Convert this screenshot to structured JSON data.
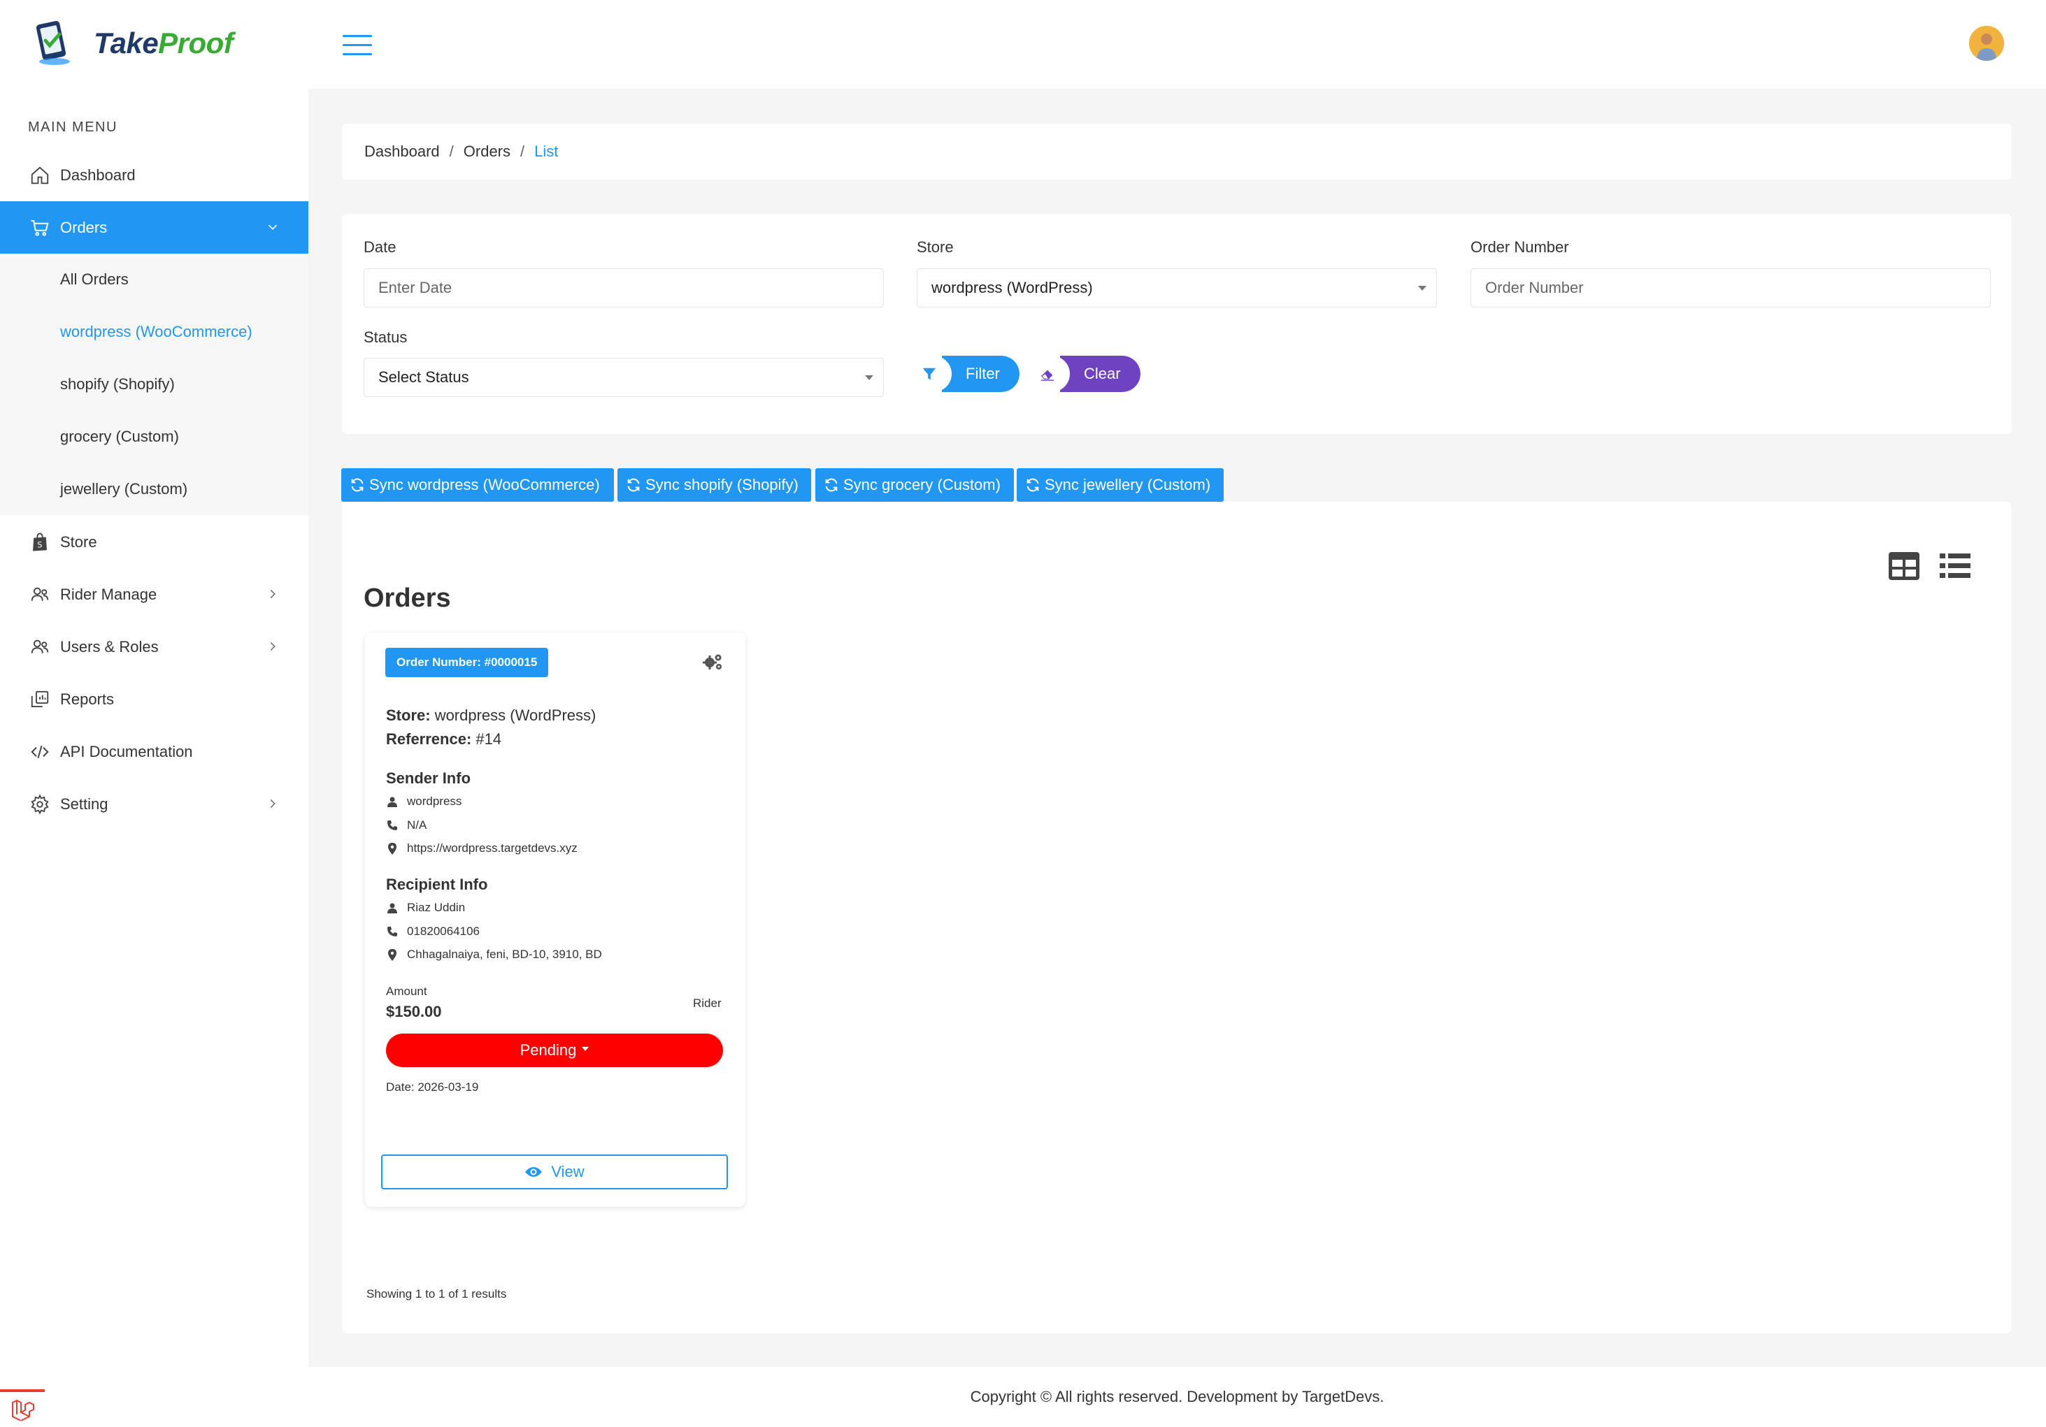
{
  "app": {
    "logo_text_1": "Take",
    "logo_text_2": "Proof"
  },
  "sidebar": {
    "menu_title": "MAIN MENU",
    "items": [
      {
        "label": "Dashboard",
        "icon": "home-icon"
      },
      {
        "label": "Orders",
        "icon": "cart-icon"
      },
      {
        "label": "Store",
        "icon": "shopify-bag-icon"
      },
      {
        "label": "Rider Manage",
        "icon": "users-icon"
      },
      {
        "label": "Users & Roles",
        "icon": "users-icon"
      },
      {
        "label": "Reports",
        "icon": "reports-icon"
      },
      {
        "label": "API Documentation",
        "icon": "code-icon"
      },
      {
        "label": "Setting",
        "icon": "gear-icon"
      }
    ],
    "orders_sub": [
      {
        "label": "All Orders"
      },
      {
        "label": "wordpress (WooCommerce)"
      },
      {
        "label": "shopify (Shopify)"
      },
      {
        "label": "grocery (Custom)"
      },
      {
        "label": "jewellery (Custom)"
      }
    ]
  },
  "breadcrumb": {
    "items": [
      "Dashboard",
      "Orders",
      "List"
    ],
    "separator": "/"
  },
  "filters": {
    "date_label": "Date",
    "date_placeholder": "Enter Date",
    "store_label": "Store",
    "store_value": "wordpress (WordPress)",
    "order_number_label": "Order Number",
    "order_number_placeholder": "Order Number",
    "status_label": "Status",
    "status_value": "Select Status",
    "filter_button": "Filter",
    "clear_button": "Clear"
  },
  "sync_buttons": [
    "Sync wordpress (WooCommerce)",
    "Sync shopify (Shopify)",
    "Sync grocery (Custom)",
    "Sync jewellery (Custom)"
  ],
  "orders": {
    "title": "Orders",
    "card": {
      "order_number": "Order Number: #0000015",
      "store_label": "Store:",
      "store_value": "wordpress (WordPress)",
      "reference_label": "Referrence:",
      "reference_value": "#14",
      "sender_title": "Sender Info",
      "sender_name": "wordpress",
      "sender_phone": "N/A",
      "sender_address": "https://wordpress.targetdevs.xyz",
      "recipient_title": "Recipient Info",
      "recipient_name": "Riaz Uddin",
      "recipient_phone": "01820064106",
      "recipient_address": "Chhagalnaiya, feni, BD-10, 3910, BD",
      "amount_label": "Amount",
      "amount_value": "$150.00",
      "rider_label": "Rider",
      "status": "Pending",
      "date": "Date: 2026-03-19",
      "view_button": "View"
    },
    "results_text": "Showing 1 to 1 of 1 results"
  },
  "footer": {
    "text": "Copyright © All rights reserved. Development by TargetDevs."
  },
  "colors": {
    "primary": "#2196f3",
    "filter_button": "#2196f3",
    "clear_button": "#6f42c1",
    "status_pending": "#ff0000",
    "logo_dark": "#1f3a68",
    "logo_green": "#3aa935"
  }
}
